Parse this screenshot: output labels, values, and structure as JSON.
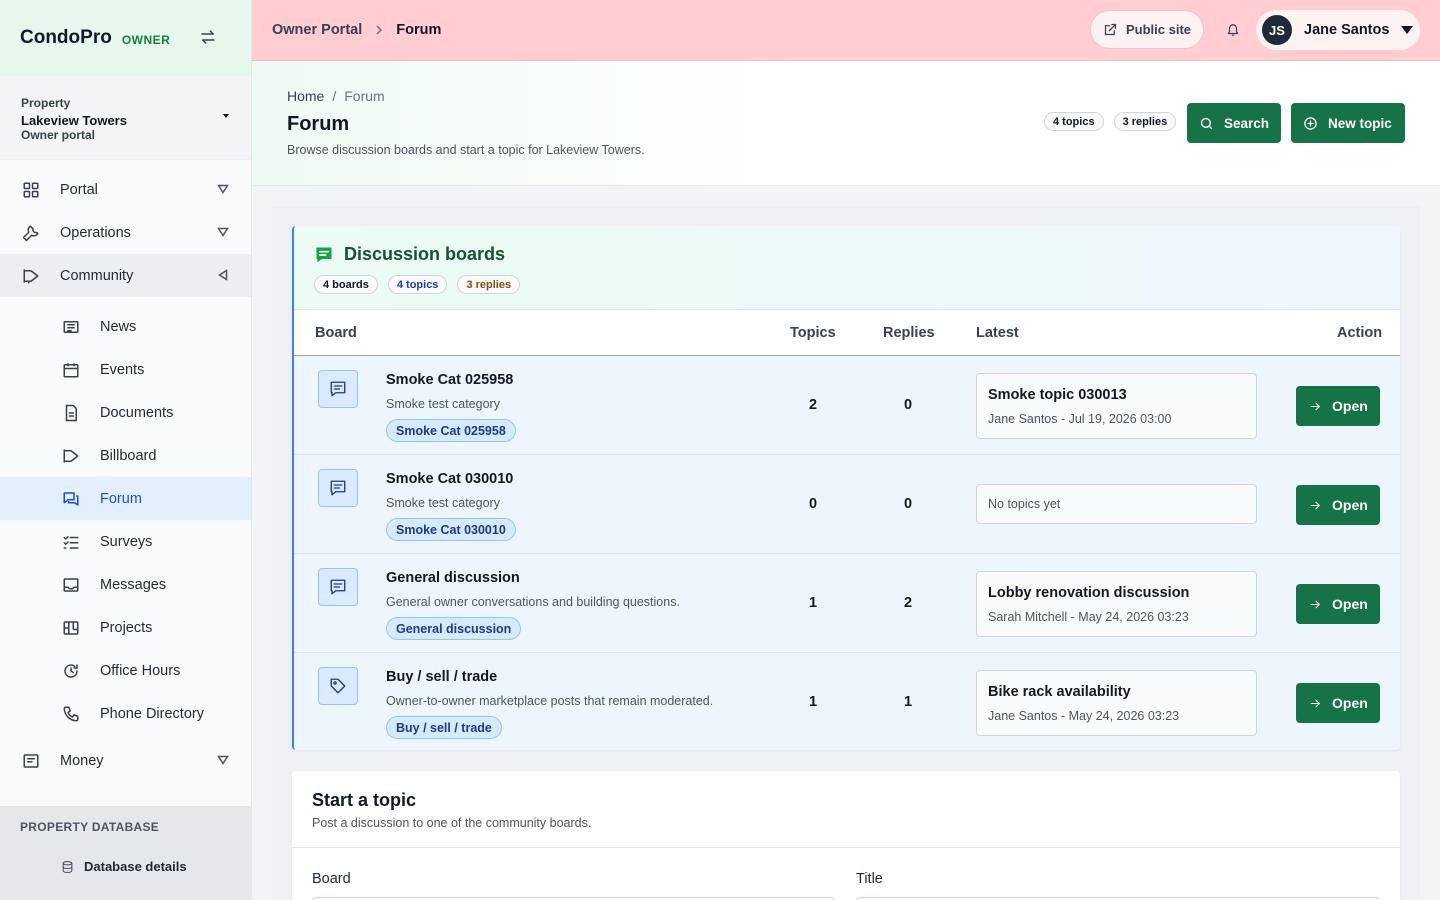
{
  "brand": {
    "name": "CondoPro",
    "tag": "OWNER"
  },
  "property": {
    "label": "Property",
    "name": "Lakeview Towers",
    "sub": "Owner portal"
  },
  "nav": {
    "portal": "Portal",
    "operations": "Operations",
    "community": "Community",
    "money": "Money",
    "sub_items": [
      "News",
      "Events",
      "Documents",
      "Billboard",
      "Forum",
      "Surveys",
      "Messages",
      "Projects",
      "Office Hours",
      "Phone Directory"
    ]
  },
  "database": {
    "title": "PROPERTY DATABASE",
    "item": "Database details"
  },
  "topbar": {
    "crumb_root": "Owner Portal",
    "crumb_current": "Forum",
    "public_site": "Public site",
    "user_initials": "JS",
    "user_name": "Jane Santos"
  },
  "header": {
    "bc_home": "Home",
    "bc_sep": "/",
    "bc_current": "Forum",
    "title": "Forum",
    "description": "Browse discussion boards and start a topic for Lakeview Towers.",
    "pill_topics": "4 topics",
    "pill_replies": "3 replies",
    "search_label": "Search",
    "new_topic_label": "New topic"
  },
  "boards": {
    "title": "Discussion boards",
    "pills": [
      "4 boards",
      "4 topics",
      "3 replies"
    ],
    "columns": {
      "board": "Board",
      "topics": "Topics",
      "replies": "Replies",
      "latest": "Latest",
      "action": "Action"
    },
    "open_label": "Open",
    "rows": [
      {
        "name": "Smoke Cat 025958",
        "desc": "Smoke test category",
        "tag": "Smoke Cat 025958",
        "topics": "2",
        "replies": "0",
        "latest_title": "Smoke topic 030013",
        "latest_meta": "Jane Santos - Jul 19, 2026 03:00",
        "icon": "chat-icon"
      },
      {
        "name": "Smoke Cat 030010",
        "desc": "Smoke test category",
        "tag": "Smoke Cat 030010",
        "topics": "0",
        "replies": "0",
        "latest_empty": "No topics yet",
        "icon": "chat-icon"
      },
      {
        "name": "General discussion",
        "desc": "General owner conversations and building questions.",
        "tag": "General discussion",
        "topics": "1",
        "replies": "2",
        "latest_title": "Lobby renovation discussion",
        "latest_meta": "Sarah Mitchell - May 24, 2026 03:23",
        "icon": "chat-icon"
      },
      {
        "name": "Buy / sell / trade",
        "desc": "Owner-to-owner marketplace posts that remain moderated.",
        "tag": "Buy / sell / trade",
        "topics": "1",
        "replies": "1",
        "latest_title": "Bike rack availability",
        "latest_meta": "Jane Santos - May 24, 2026 03:23",
        "icon": "tag-icon"
      }
    ]
  },
  "start_topic": {
    "title": "Start a topic",
    "description": "Post a discussion to one of the community boards.",
    "board_label": "Board",
    "title_label": "Title"
  },
  "colors": {
    "accent": "#157347",
    "topbar": "#ffcdd2",
    "active_nav": "#1d4ed8"
  }
}
